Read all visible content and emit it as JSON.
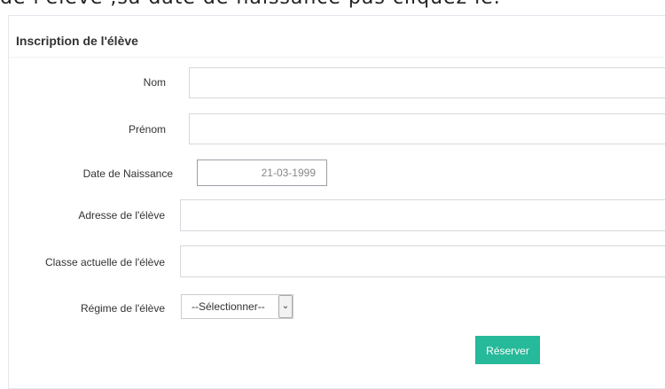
{
  "caption": "de l'élève ,sa date de  naissance pas cliquéz le.",
  "form": {
    "title": "Inscription de l'élève",
    "fields": {
      "nom": {
        "label": "Nom",
        "value": ""
      },
      "prenom": {
        "label": "Prénom",
        "value": ""
      },
      "date_naissance": {
        "label": "Date de Naissance",
        "value": "21-03-1999"
      },
      "adresse": {
        "label": "Adresse de l'élève",
        "value": ""
      },
      "classe": {
        "label": "Classe actuelle de l'élève",
        "value": ""
      },
      "regime": {
        "label": "Régime de l'élève",
        "selected": "--Sélectionner--"
      }
    },
    "submit_label": "Réserver"
  },
  "icons": {
    "select_arrow": "chevron-down-icon"
  },
  "colors": {
    "accent": "#26b99a",
    "border": "#e3e8ee"
  }
}
